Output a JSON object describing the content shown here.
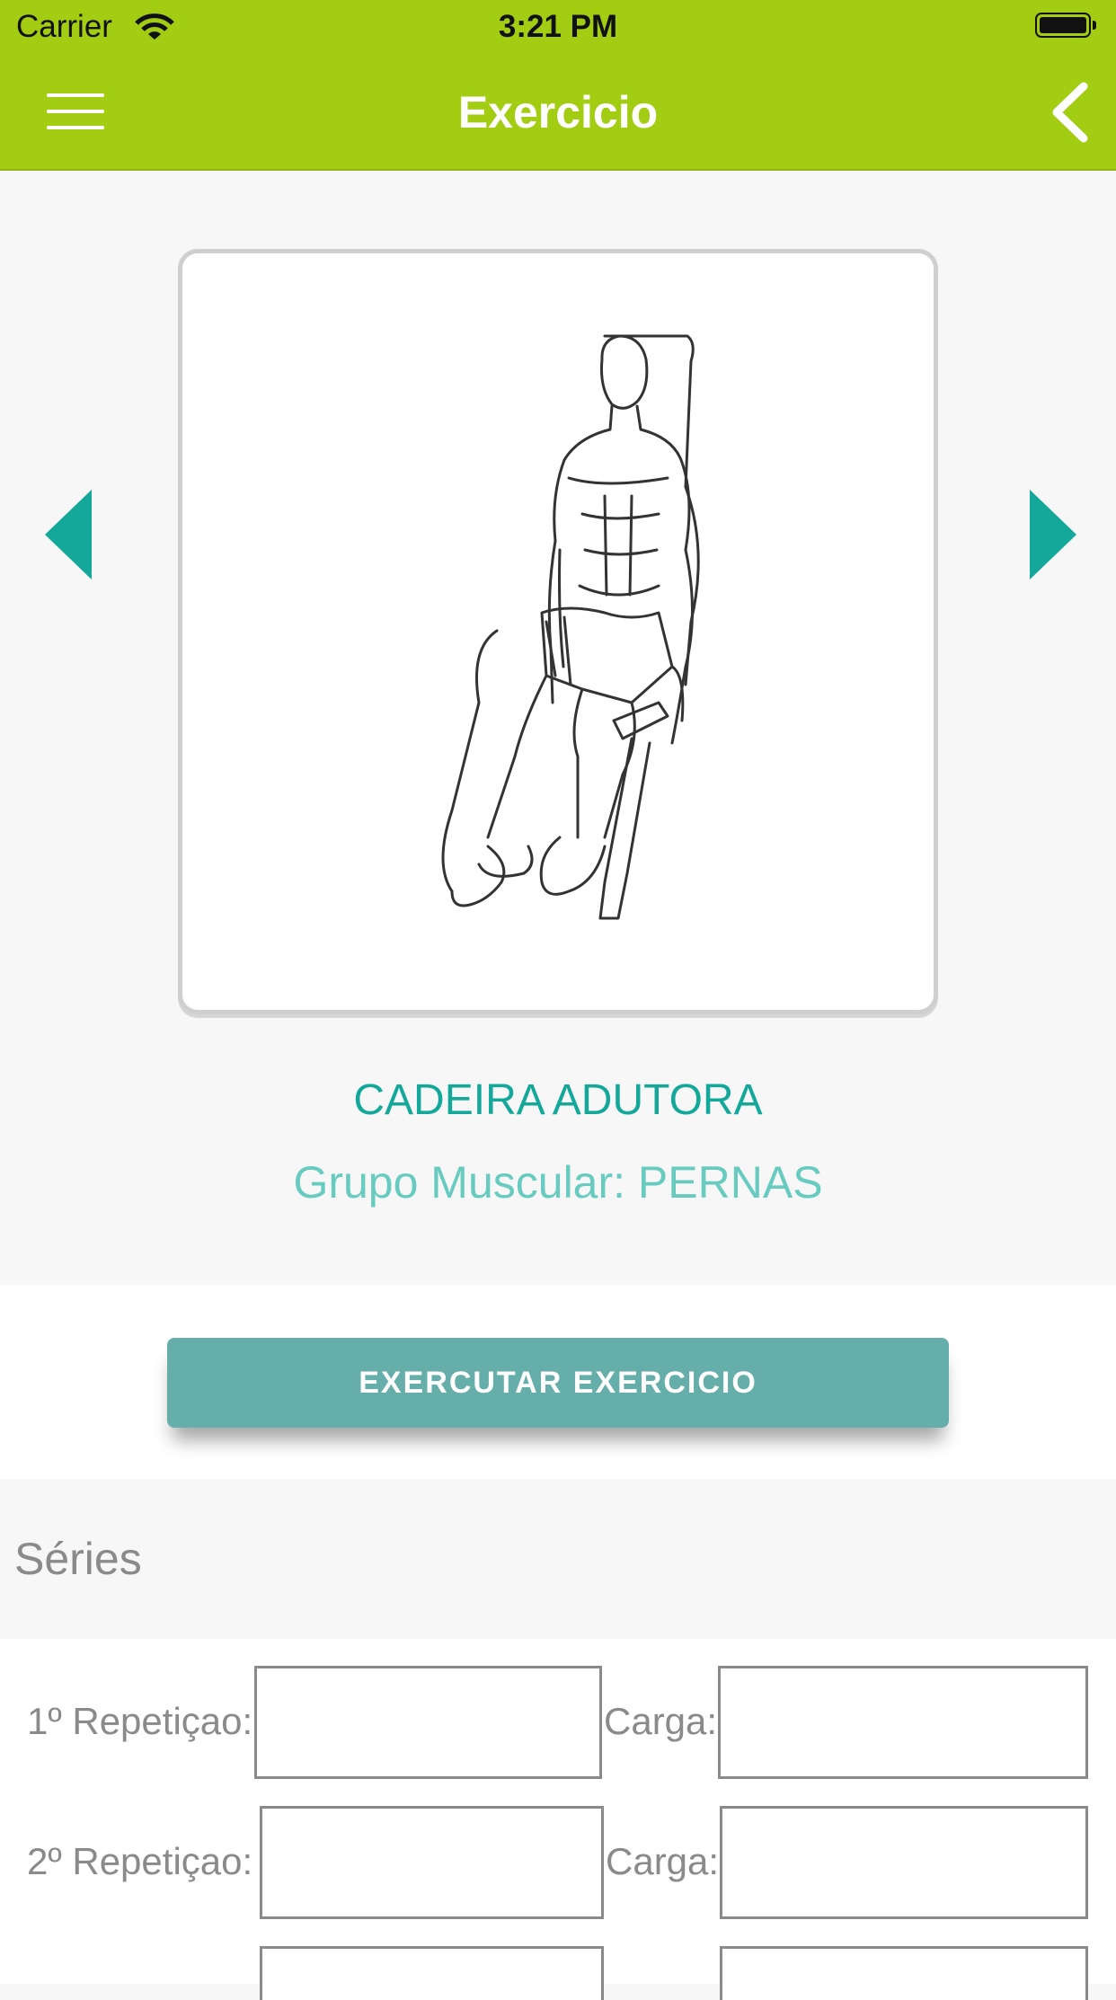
{
  "status_bar": {
    "carrier": "Carrier",
    "time": "3:21 PM"
  },
  "nav": {
    "title": "Exercicio"
  },
  "exercise": {
    "name": "CADEIRA ADUTORA",
    "muscle_group": "Grupo Muscular: PERNAS"
  },
  "execute_button": {
    "label": "EXERCUTAR EXERCICIO"
  },
  "series": {
    "title": "Séries",
    "rows": [
      {
        "rep_label": "1º Repetiçao:",
        "rep_value": "",
        "load_label": "Carga:",
        "load_value": ""
      },
      {
        "rep_label": "2º Repetiçao:",
        "rep_value": "",
        "load_label": "Carga:",
        "load_value": ""
      }
    ]
  },
  "colors": {
    "nav_bg": "#a2cd13",
    "accent_teal": "#13a89a",
    "button_bg": "#65aea9"
  }
}
